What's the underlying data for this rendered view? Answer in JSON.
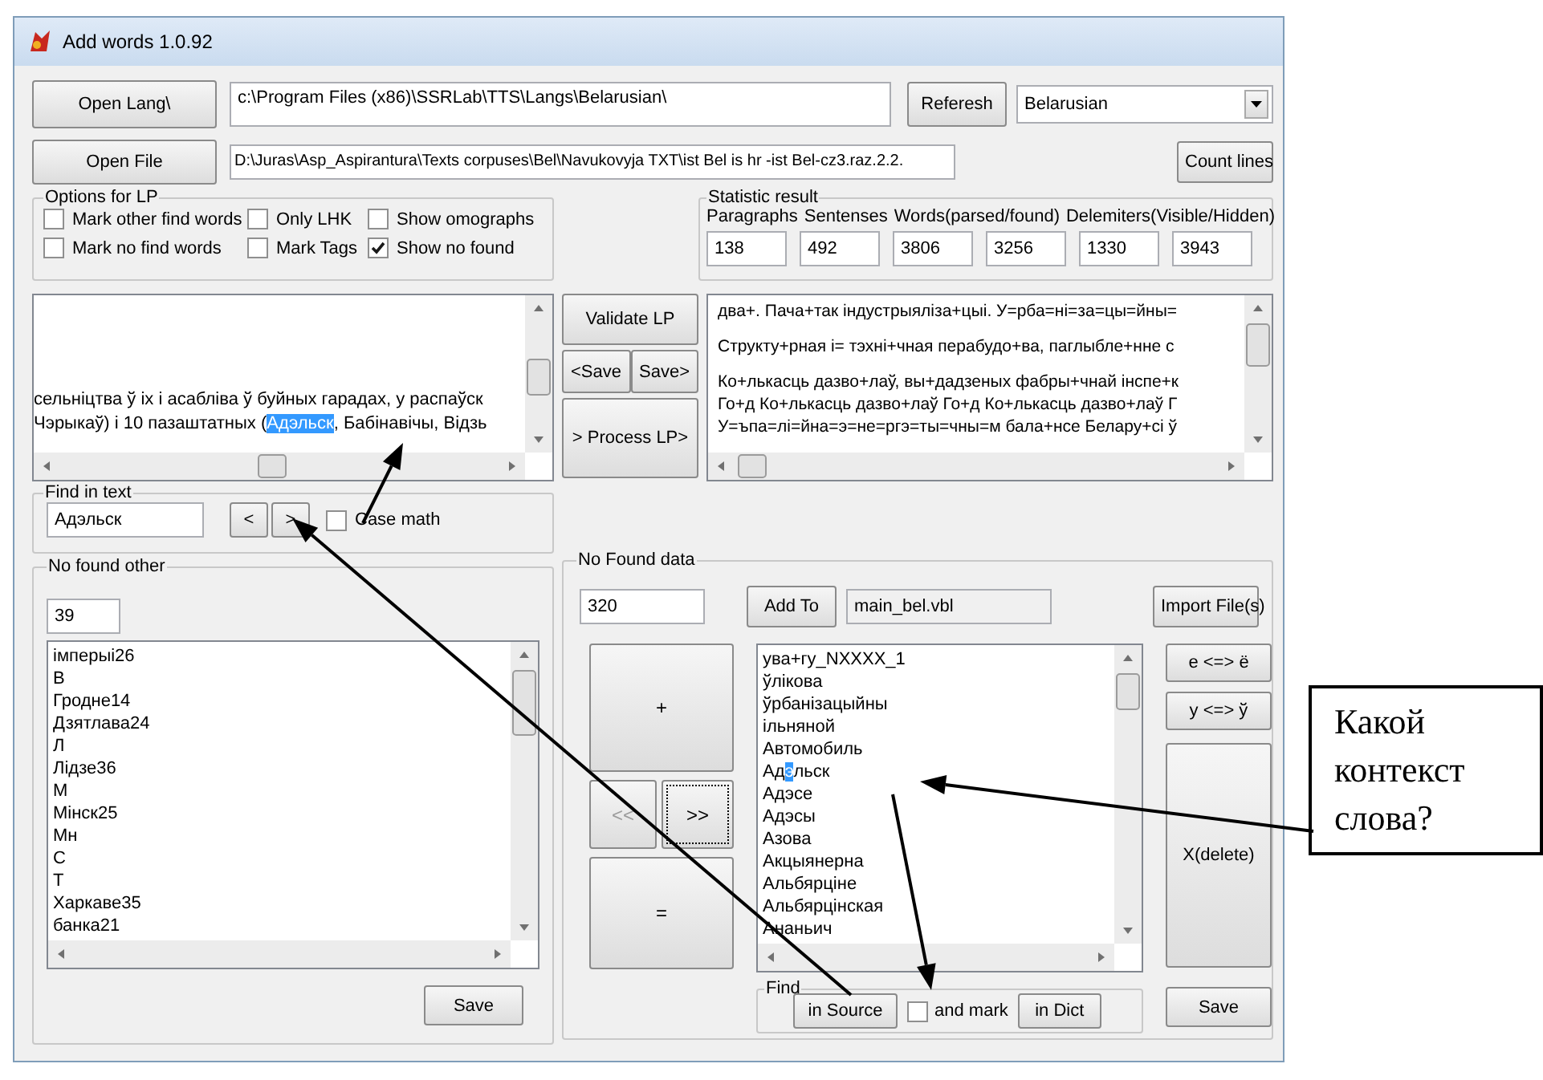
{
  "window": {
    "title": "Add words 1.0.92"
  },
  "lang_row": {
    "button": "Open Lang\\",
    "path": "c:\\Program Files (x86)\\SSRLab\\TTS\\Langs\\Belarusian\\",
    "refresh_button": "Referesh",
    "language": "Belarusian"
  },
  "file_row": {
    "button": "Open File",
    "path": "D:\\Juras\\Asp_Aspirantura\\Texts corpuses\\Bel\\Navukovyja TXT\\ist Bel is hr -ist Bel-cz3.raz.2.2.",
    "count_button": "Count lines"
  },
  "options": {
    "title": "Options for LP",
    "checkboxes": [
      {
        "label": "Mark other find words",
        "checked": false
      },
      {
        "label": "Only LHK",
        "checked": false
      },
      {
        "label": "Show omographs",
        "checked": false
      },
      {
        "label": "Mark no find words",
        "checked": false
      },
      {
        "label": "Mark Tags",
        "checked": false
      },
      {
        "label": "Show no found",
        "checked": true
      }
    ]
  },
  "statistics": {
    "title": "Statistic result",
    "headers": [
      "Paragraphs",
      "Sentenses",
      "Words(parsed/found)",
      "Delemiters(Visible/Hidden)"
    ],
    "values": [
      "138",
      "492",
      "3806",
      "3256",
      "1330",
      "3943"
    ]
  },
  "source_text": {
    "lines": [
      {
        "text": "сельніцтва ў іх і асабліва ў буйных гарадах, у распаўск"
      },
      {
        "text": "Чэрыкаў) і 10 пазаштатных (",
        "highlight": "Адэльск",
        "rest": ", Бабінавічы, Відзь"
      }
    ]
  },
  "lp_buttons": {
    "validate": "Validate LP",
    "save_left": "<Save",
    "save_right": "Save>",
    "process": "> Process LP>"
  },
  "processed_text": {
    "paragraphs": [
      [
        "два+. Пача+так індустрыяліза+цыі. У=рба=ні=за=цы=йны="
      ],
      [
        "Структу+рная і= тэхні+чная перабудо+ва, паглыбле+нне с"
      ],
      [
        "Ко+лькасць дазво+лаў, вы+дадзеных фабры+чнай інспе+к",
        "Го+д Ко+лькасць дазво+лаў Го+д Ко+лькасць дазво+лаў Г",
        "У=ъпа=лі=йна=э=не=ргэ=ты=чны=м бала+нсе Белару+сі ў"
      ]
    ]
  },
  "find_in_text": {
    "title": "Find in text",
    "value": "Адэльск",
    "prev_button": "<",
    "next_button": ">",
    "case_checkbox": {
      "label": "Case math",
      "checked": false
    }
  },
  "no_found_other": {
    "title": "No found other",
    "count": "39",
    "items": [
      "імперыі26",
      "В",
      "Гродне14",
      "Дзятлава24",
      "Л",
      "Лідзе36",
      "М",
      "Мінск25",
      "Мн",
      "С",
      "Т",
      "Харкаве35",
      "банка21"
    ],
    "save_button": "Save"
  },
  "no_found_data": {
    "title": "No Found data",
    "count": "320",
    "add_button": "Add To",
    "dictionary": {
      "value": "main_bel.vbl",
      "disabled": true
    },
    "import_button": "Import File(s)",
    "move_buttons": [
      {
        "label": "+",
        "kind": "wide",
        "disabled": false,
        "focused": false
      },
      {
        "label": "<<",
        "kind": "half",
        "disabled": true,
        "focused": false
      },
      {
        "label": ">>",
        "kind": "half",
        "disabled": false,
        "focused": true
      },
      {
        "label": "=",
        "kind": "wide",
        "disabled": false,
        "focused": false
      }
    ],
    "items": [
      {
        "text": "ува+гу_NXXXX_1"
      },
      {
        "text": "ўлікова"
      },
      {
        "text": "ўрбанізацыйны"
      },
      {
        "text": "ільняной"
      },
      {
        "text": "Автомобиль"
      },
      {
        "text": "Ад",
        "highlight": "э",
        "rest": "льск"
      },
      {
        "text": "Адэсе"
      },
      {
        "text": "Адэсы"
      },
      {
        "text": "Азова"
      },
      {
        "text": "Акцыянерна"
      },
      {
        "text": "Альбярціне"
      },
      {
        "text": "Альбярцінская"
      },
      {
        "text": "Ананьич"
      }
    ],
    "find": {
      "title": "Find",
      "source_button": "in Source",
      "mark_checkbox": {
        "label": "and mark",
        "checked": false
      },
      "dict_button": "in Dict"
    },
    "side_buttons": [
      "e <=> ё",
      "y <=> ў",
      "X(delete)"
    ],
    "save_button": "Save"
  },
  "callout": {
    "text": "Какой контекст слова?"
  }
}
